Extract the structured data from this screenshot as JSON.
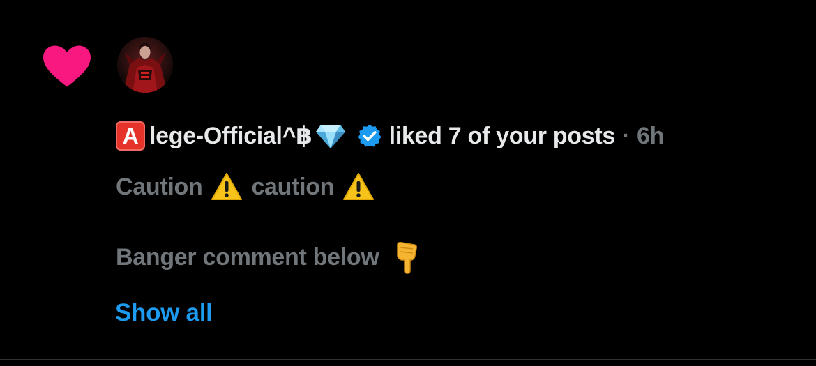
{
  "notification": {
    "type": "like",
    "user": {
      "badge_letter": "A",
      "name": "lege-Official^฿",
      "verified": true
    },
    "action": "liked 7 of your posts",
    "separator": "·",
    "time": "6h",
    "post_preview": {
      "line1_a": "Caution",
      "line1_b": "caution",
      "line2": "Banger comment below"
    },
    "show_all_label": "Show all"
  },
  "colors": {
    "background": "#000000",
    "heart": "#f91880",
    "primary_text": "#e7e9ea",
    "secondary_text": "#71767b",
    "link": "#1d9bf0",
    "verified": "#1d9bf0",
    "badge": "#e6332a"
  },
  "icons": {
    "heart": "heart-icon",
    "gem": "gem-icon",
    "verified": "verified-badge-icon",
    "warning": "warning-icon",
    "pointing": "pointing-down-icon"
  }
}
